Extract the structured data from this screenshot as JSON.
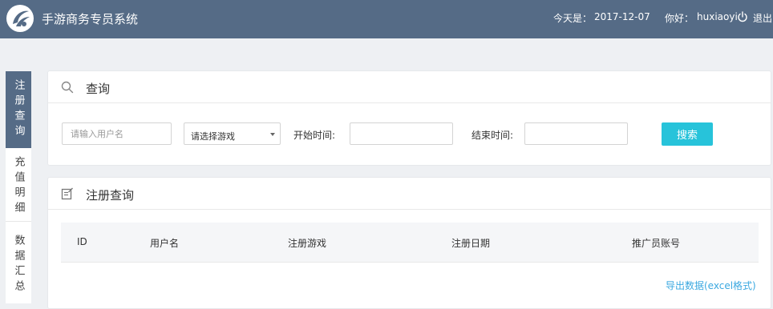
{
  "header": {
    "app_title": "手游商务专员系统",
    "date_label": "今天是：",
    "date_value": "2017-12-07",
    "hello_label": "你好：",
    "username": "huxiaoyi",
    "logout_label": "退出"
  },
  "sidebar": {
    "items": [
      {
        "label": "注册查询",
        "active": true
      },
      {
        "label": "充值明细",
        "active": false
      },
      {
        "label": "数据汇总",
        "active": false
      }
    ]
  },
  "search_panel": {
    "title": "查询",
    "user_placeholder": "请输入用户名",
    "game_select": "请选择游戏",
    "start_label": "开始时间:",
    "start_value": "",
    "end_label": "结束时间:",
    "end_value": "",
    "search_button": "搜索"
  },
  "result_panel": {
    "title": "注册查询",
    "columns": [
      "ID",
      "用户名",
      "注册游戏",
      "注册日期",
      "推广员账号"
    ],
    "rows": [],
    "export_link": "导出数据(excel格式)"
  },
  "colors": {
    "header_bg": "#556b86",
    "accent": "#27c3da",
    "link": "#3aa8e0",
    "page_bg": "#eef0f3"
  }
}
